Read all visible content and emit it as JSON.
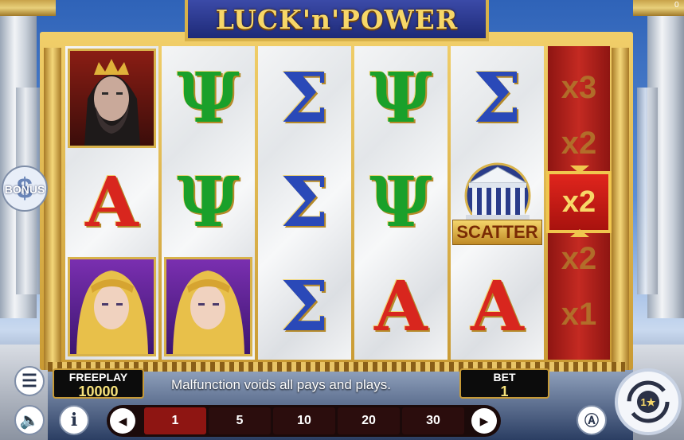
{
  "game": {
    "title": "LUCK'n'POWER",
    "corner_counter": "0"
  },
  "reels": [
    [
      "portrait-king",
      "alpha",
      "portrait-goddess"
    ],
    [
      "psi",
      "psi",
      "portrait-goddess"
    ],
    [
      "sigma",
      "sigma",
      "sigma"
    ],
    [
      "psi",
      "psi",
      "alpha"
    ],
    [
      "sigma",
      "scatter",
      "alpha"
    ]
  ],
  "symbols": {
    "psi": "Ψ",
    "sigma": "Σ",
    "alpha": "Α",
    "scatter_label": "SCATTER"
  },
  "multiplier_reel": {
    "values": [
      "x3",
      "x2",
      "x2",
      "x2",
      "x1"
    ],
    "active": "x2"
  },
  "bonus_button": {
    "label": "BONUS"
  },
  "freeplay": {
    "label": "FREEPLAY",
    "value": "10000"
  },
  "bet": {
    "label": "BET",
    "value": "1"
  },
  "message": "Malfunction voids all pays and plays.",
  "bet_options": [
    "1",
    "5",
    "10",
    "20",
    "30"
  ],
  "selected_bet": "1",
  "icons": {
    "menu": "menu-icon",
    "sound": "sound-icon",
    "info": "info-icon",
    "prev": "chevron-left-icon",
    "next": "chevron-right-icon",
    "autoplay": "autoplay-icon",
    "spin": "spin-icon"
  },
  "colors": {
    "frame_gold": "#d8b24a",
    "multiplier_red": "#c42a22",
    "psi_green": "#1aa02a",
    "sigma_blue": "#2a49b8",
    "alpha_red": "#d8261e"
  }
}
